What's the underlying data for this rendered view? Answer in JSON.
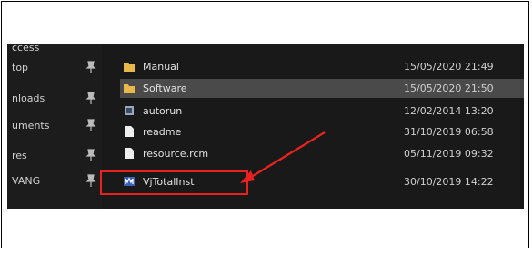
{
  "nav": {
    "items": [
      {
        "label": "ccess",
        "icon": "quick-access-icon"
      },
      {
        "label": "top",
        "icon": "pin-icon"
      },
      {
        "label": "nloads",
        "icon": "pin-icon"
      },
      {
        "label": "uments",
        "icon": "pin-icon"
      },
      {
        "label": "res",
        "icon": "pin-icon"
      },
      {
        "label": "VANG",
        "icon": "pin-icon"
      }
    ]
  },
  "files": [
    {
      "name": "Manual",
      "date": "15/05/2020 21:49",
      "icon": "folder-icon",
      "selected": false
    },
    {
      "name": "Software",
      "date": "15/05/2020 21:50",
      "icon": "folder-icon",
      "selected": true
    },
    {
      "name": "autorun",
      "date": "12/02/2014 13:20",
      "icon": "autorun-icon",
      "selected": false
    },
    {
      "name": "readme",
      "date": "31/10/2019 06:58",
      "icon": "file-icon",
      "selected": false
    },
    {
      "name": "resource.rcm",
      "date": "05/11/2019 09:32",
      "icon": "file-icon",
      "selected": false
    },
    {
      "name": "VjTotalInst",
      "date": "30/10/2019 14:22",
      "icon": "installer-icon",
      "selected": false
    }
  ],
  "colors": {
    "annotation": "#e8231f",
    "folder": "#e8b84a",
    "selection": "#4a4a4a",
    "background": "#191919"
  }
}
